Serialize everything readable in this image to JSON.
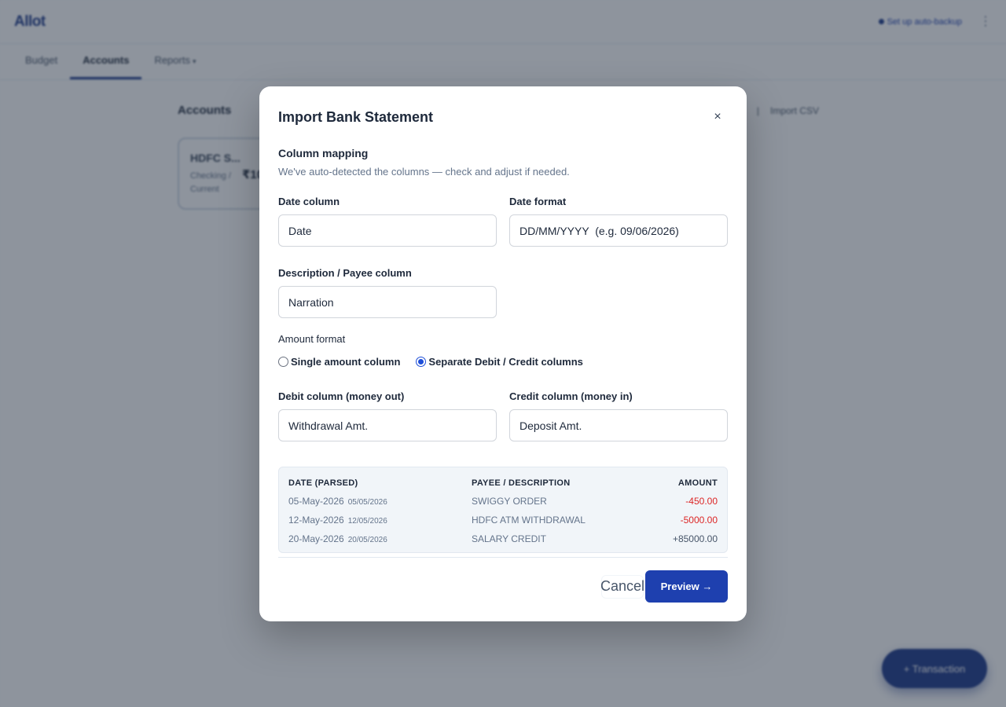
{
  "app": {
    "logo": "Allot",
    "backup_link": "Set up auto-backup",
    "menu_icon": "kebab-icon",
    "nav": [
      {
        "label": "Budget"
      },
      {
        "label": "Accounts"
      },
      {
        "label": "Reports"
      }
    ],
    "nav_caret": "▾",
    "page_heading": "Accounts",
    "actions": [
      "|",
      "Import CSV"
    ],
    "account_card": {
      "name": "HDFC S...",
      "type": "Checking / Current",
      "balance": "₹10"
    },
    "fab_label": "+ Transaction"
  },
  "modal": {
    "title": "Import Bank Statement",
    "close": "×",
    "section_title": "Column mapping",
    "section_sub": "We've auto-detected the columns — check and adjust if needed.",
    "date_column": {
      "label": "Date column",
      "value": "Date"
    },
    "date_format": {
      "label": "Date format",
      "value": "DD/MM/YYYY  (e.g. 09/06/2026)"
    },
    "payee_column": {
      "label": "Description / Payee column",
      "value": "Narration"
    },
    "amount_format": {
      "label": "Amount format",
      "options": [
        "Single amount column",
        "Separate Debit / Credit columns"
      ],
      "selected": "Separate Debit / Credit columns"
    },
    "debit_column": {
      "label": "Debit column (money out)",
      "value": "Withdrawal Amt."
    },
    "credit_column": {
      "label": "Credit column (money in)",
      "value": "Deposit Amt."
    },
    "preview": {
      "headers": [
        "DATE (PARSED)",
        "PAYEE / DESCRIPTION",
        "AMOUNT"
      ],
      "rows": [
        {
          "date": "05-May-2026",
          "raw": "05/05/2026",
          "payee": "SWIGGY ORDER",
          "amount": "-450.00"
        },
        {
          "date": "12-May-2026",
          "raw": "12/05/2026",
          "payee": "HDFC ATM WITHDRAWAL",
          "amount": "-5000.00"
        },
        {
          "date": "20-May-2026",
          "raw": "20/05/2026",
          "payee": "SALARY CREDIT",
          "amount": "+85000.00"
        }
      ]
    },
    "cancel_label": "Cancel",
    "preview_label": "Preview →"
  },
  "colors": {
    "primary": "#1e40af",
    "negative": "#dc2626",
    "overlay": "rgba(30,41,59,0.5)"
  }
}
